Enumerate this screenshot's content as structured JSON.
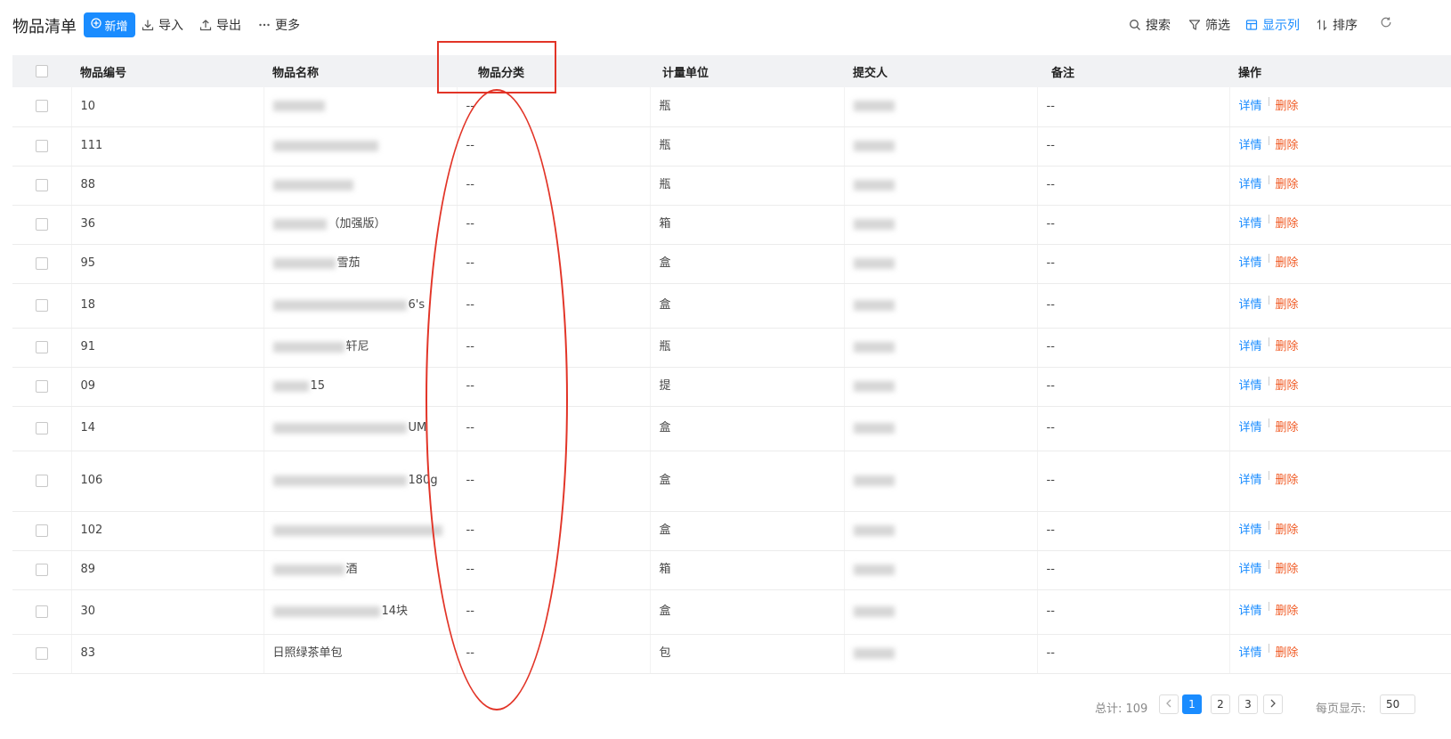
{
  "toolbar": {
    "title": "物品清单",
    "new_label": "新增",
    "import_label": "导入",
    "export_label": "导出",
    "more_label": "更多",
    "search_label": "搜索",
    "filter_label": "筛选",
    "columns_label": "显示列",
    "sort_label": "排序"
  },
  "table": {
    "headers": {
      "code": "物品编号",
      "name": "物品名称",
      "category": "物品分类",
      "unit": "计量单位",
      "submitter": "提交人",
      "note": "备注",
      "action": "操作"
    },
    "action_labels": {
      "detail": "详情",
      "delete": "删除"
    },
    "rows": [
      {
        "code": "10",
        "name": "",
        "category": "--",
        "unit": "瓶",
        "submitter": "",
        "note": "--"
      },
      {
        "code": "111",
        "name": "",
        "category": "--",
        "unit": "瓶",
        "submitter": "",
        "note": "--"
      },
      {
        "code": "88",
        "name": "",
        "category": "--",
        "unit": "瓶",
        "submitter": "",
        "note": "--"
      },
      {
        "code": "36",
        "name": "（加强版）",
        "category": "--",
        "unit": "箱",
        "submitter": "",
        "note": "--"
      },
      {
        "code": "95",
        "name": "雪茄",
        "category": "--",
        "unit": "盒",
        "submitter": "",
        "note": "--"
      },
      {
        "code": "18",
        "name": "6's",
        "category": "--",
        "unit": "盒",
        "submitter": "",
        "note": "--"
      },
      {
        "code": "91",
        "name": "轩尼",
        "category": "--",
        "unit": "瓶",
        "submitter": "",
        "note": "--"
      },
      {
        "code": "09",
        "name": "15",
        "category": "--",
        "unit": "提",
        "submitter": "",
        "note": "--"
      },
      {
        "code": "14",
        "name": "UM",
        "category": "--",
        "unit": "盒",
        "submitter": "",
        "note": "--"
      },
      {
        "code": "106",
        "name": "180g",
        "category": "--",
        "unit": "盒",
        "submitter": "",
        "note": "--"
      },
      {
        "code": "102",
        "name": "",
        "category": "--",
        "unit": "盒",
        "submitter": "",
        "note": "--"
      },
      {
        "code": "89",
        "name": "酒",
        "category": "--",
        "unit": "箱",
        "submitter": "",
        "note": "--"
      },
      {
        "code": "30",
        "name": "14块",
        "category": "--",
        "unit": "盒",
        "submitter": "",
        "note": "--"
      },
      {
        "code": "83",
        "name": "日照绿茶单包",
        "category": "--",
        "unit": "包",
        "submitter": "",
        "note": "--"
      }
    ]
  },
  "pagination": {
    "total_label": "总计: 109",
    "pages": [
      "1",
      "2",
      "3"
    ],
    "current_page": 1,
    "per_page_label": "每页显示:",
    "per_page_value": "50"
  },
  "colors": {
    "accent": "#1a8cff",
    "delete": "#f05a24",
    "annotation": "#e23427"
  }
}
